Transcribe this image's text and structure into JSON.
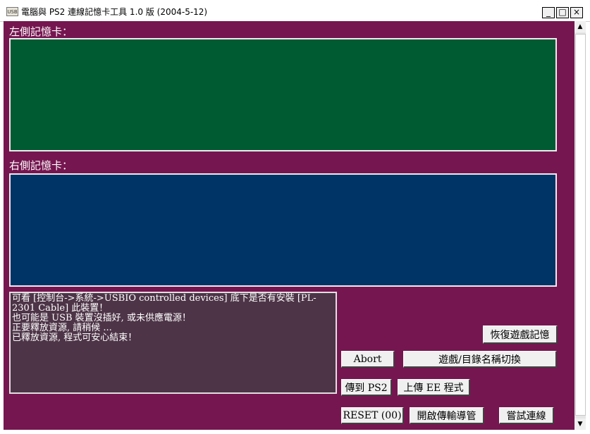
{
  "window": {
    "title": "電腦與 PS2 連線記憶卡工具 1.0 版 (2004-5-12)",
    "icon": "usb-app-icon",
    "icon_text": "USB",
    "minimize": "_",
    "maximize": "□",
    "close": "×"
  },
  "left_card": {
    "label": "左側記憶卡：",
    "color": "#005a32"
  },
  "right_card": {
    "label": "右側記憶卡：",
    "color": "#003366"
  },
  "log": {
    "lines": [
      "可看 [控制台->系統->USBIO controlled devices] 底下是否有安裝 [PL-2301 Cable] 此裝置！",
      "也可能是 USB 裝置沒插好, 或未供應電源！",
      "正要釋放資源, 請稍候 ...",
      "已釋放資源, 程式可安心結束！"
    ]
  },
  "buttons": {
    "restore_save": "恢復遊戲記憶",
    "abort": "Abort",
    "toggle_names": "遊戲/目錄名稱切換",
    "send_to_ps2": "傳到 PS2",
    "upload_ee": "上傳 EE 程式",
    "reset": "RESET (00)",
    "open_pipe": "開啟傳輸導管",
    "try_connect": "嘗試連線"
  },
  "colors": {
    "background": "#751650",
    "log_background": "#4d3447"
  },
  "scrollbar": {
    "up": "▲",
    "down": "▼"
  }
}
